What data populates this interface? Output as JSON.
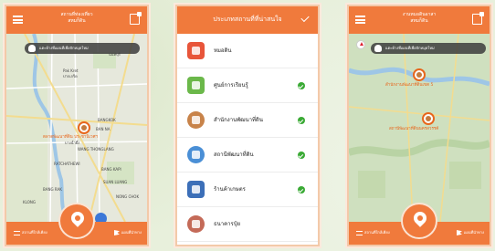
{
  "screens": {
    "map1": {
      "title_line1": "สถานที่ท่องเที่ยว",
      "title_line2": "สหมก็ดิน",
      "tooltip": "แตะค้างที่แผนที่เพื่อปักหมุดใหม่",
      "labels": {
        "l1": "Pak Kret",
        "l2": "ปากเกร็ด",
        "l3": "นนทบุรี",
        "l4": "BANGKOK",
        "l5": "BANG RAK",
        "l6": "WANG THONGLANG",
        "l7": "BAN NA",
        "l8": "BANG KAPI",
        "l9": "RATCHATHEWI",
        "l10": "SUAN LUANG",
        "l11": "KLONG",
        "l12": "NONG CHOK",
        "poi": "ตลาดพัฒนาที่ดิน ประชานิเวศฯ",
        "poi2": "บางน้ำผึ้ง"
      },
      "bottom_left": "สถานที่ใกล้เคียง",
      "bottom_right": "แผนที่นำทาง"
    },
    "categories": {
      "title": "ประเภทสถานที่ที่น่าสนใจ",
      "items": [
        {
          "label": "หมอดิน",
          "color": "#e8553a",
          "checked": false
        },
        {
          "label": "ศูนย์การเรียนรู้",
          "color": "#6bb84a",
          "checked": true
        },
        {
          "label": "สำนักงานพัฒนาที่ดิน",
          "color": "#c8834a",
          "checked": true
        },
        {
          "label": "สถานีพัฒนาที่ดิน",
          "color": "#4a8fd6",
          "checked": true
        },
        {
          "label": "ร้านค้าเกษตร",
          "color": "#3c6fb8",
          "checked": true
        },
        {
          "label": "ธนาคารปุ๋ย",
          "color": "#c46a58",
          "checked": false
        }
      ]
    },
    "map2": {
      "title_line1": "งานหมอดินอาสา",
      "title_line2": "สหมก็ดิน",
      "tooltip": "แตะค้างที่แผนที่เพื่อปักหมุดใหม่",
      "labels": {
        "poi1": "สำนักงานพัฒนาที่ดินเขต 5",
        "poi2": "สถานีพัฒนาที่ดินนครสวรรค์"
      },
      "bottom_left": "สถานที่ใกล้เคียง",
      "bottom_right": "แผนที่นำทาง"
    }
  },
  "colors": {
    "brand": "#f07a3c",
    "check": "#3aaa35"
  }
}
